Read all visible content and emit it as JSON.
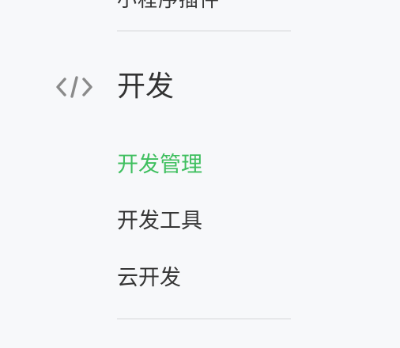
{
  "truncated_top_item": {
    "label": "小程序插件"
  },
  "section": {
    "title": "开发",
    "icon": "code-icon",
    "items": [
      {
        "label": "开发管理",
        "active": true
      },
      {
        "label": "开发工具",
        "active": false
      },
      {
        "label": "云开发",
        "active": false
      }
    ]
  },
  "colors": {
    "active": "#3fbf5f",
    "text": "#353535",
    "icon": "#8a8a8a",
    "divider": "#e7e8ea",
    "background": "#f7f8fa"
  }
}
